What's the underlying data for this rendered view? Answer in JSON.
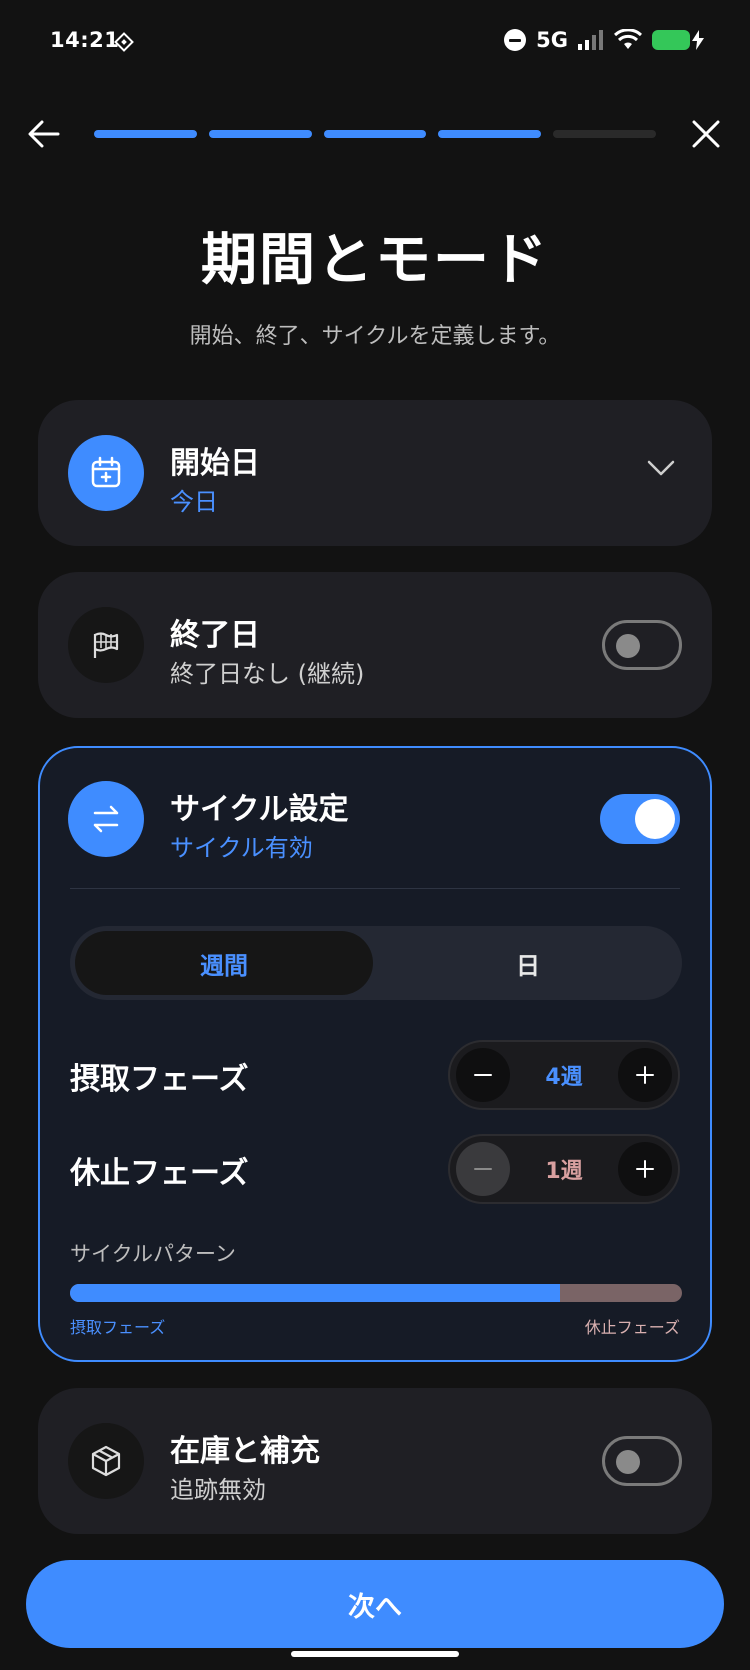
{
  "status_bar": {
    "time": "14:21",
    "network": "5G"
  },
  "header": {
    "progress_total": 5,
    "progress_done": 4,
    "title": "期間とモード",
    "subtitle": "開始、終了、サイクルを定義します。"
  },
  "start_card": {
    "title": "開始日",
    "value": "今日",
    "icon": "calendar-icon"
  },
  "end_card": {
    "title": "終了日",
    "value": "終了日なし (継続)",
    "icon": "flag-icon",
    "enabled": false
  },
  "cycle_card": {
    "title": "サイクル設定",
    "status": "サイクル有効",
    "icon": "swap-arrows-icon",
    "enabled": true,
    "unit_options": [
      "週間",
      "日"
    ],
    "selected_unit": "週間",
    "intake_label": "摂取フェーズ",
    "intake_value": "4週",
    "pause_label": "休止フェーズ",
    "pause_value": "1週",
    "pattern_label": "サイクルパターン",
    "pattern_intake_label": "摂取フェーズ",
    "pattern_pause_label": "休止フェーズ",
    "pattern_intake_fraction": 0.8
  },
  "inventory_card": {
    "title": "在庫と補充",
    "value": "追跡無効",
    "icon": "box-icon",
    "enabled": false
  },
  "footer": {
    "next_label": "次へ"
  },
  "colors": {
    "accent": "#3f8cff",
    "background": "#121212",
    "card": "#1f1f24",
    "pause": "#7a6466"
  }
}
